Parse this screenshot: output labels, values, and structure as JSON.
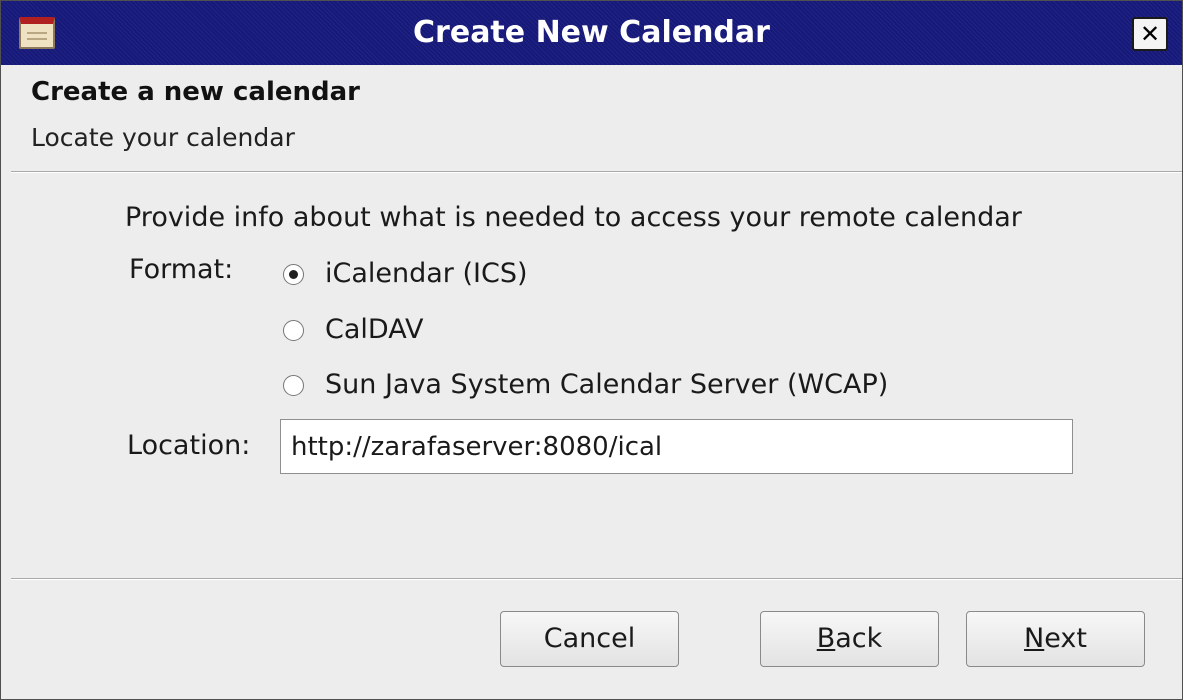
{
  "window": {
    "title": "Create New Calendar",
    "close_glyph": "✕"
  },
  "header": {
    "title": "Create a new calendar",
    "subtitle": "Locate your calendar"
  },
  "form": {
    "intro": "Provide info about what is needed to access your remote calendar",
    "format_label": "Format:",
    "format_options": [
      {
        "label": "iCalendar (ICS)",
        "checked": true
      },
      {
        "label": "CalDAV",
        "checked": false
      },
      {
        "label": "Sun Java System Calendar Server (WCAP)",
        "checked": false
      }
    ],
    "location_label": "Location:",
    "location_value": "http://zarafaserver:8080/ical"
  },
  "buttons": {
    "cancel": "Cancel",
    "back_mnemonic": "B",
    "back_rest": "ack",
    "next_mnemonic": "N",
    "next_rest": "ext"
  },
  "colors": {
    "titlebar": "#16187a",
    "window_bg": "#ededed"
  },
  "icons": {
    "app": "calendar-icon",
    "close": "close-icon"
  }
}
